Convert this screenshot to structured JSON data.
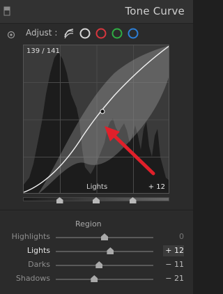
{
  "panel": {
    "title": "Tone Curve"
  },
  "adjust": {
    "label": "Adjust :",
    "channels": [
      {
        "name": "parametric",
        "icon": "parametric-curve-icon",
        "color": "#d0d0d0"
      },
      {
        "name": "rgb",
        "icon": "rgb-channel-icon",
        "color": "#d8d8d8"
      },
      {
        "name": "red",
        "icon": "red-channel-icon",
        "color": "#d9363e"
      },
      {
        "name": "green",
        "icon": "green-channel-icon",
        "color": "#2fae44"
      },
      {
        "name": "blue",
        "icon": "blue-channel-icon",
        "color": "#2c7fd8"
      }
    ]
  },
  "graph": {
    "readout": "139 / 141",
    "region_name": "Lights",
    "region_value": "+ 12",
    "annotation": {
      "icon": "red-arrow-icon",
      "color": "#e0202a"
    }
  },
  "split": {
    "handles": [
      0.25,
      0.5,
      0.75
    ]
  },
  "region": {
    "label": "Region",
    "sliders": [
      {
        "key": "highlights",
        "label": "Highlights",
        "value": "0",
        "amount": 0,
        "state": "muted"
      },
      {
        "key": "lights",
        "label": "Lights",
        "value": "+ 12",
        "amount": 12,
        "state": "active"
      },
      {
        "key": "darks",
        "label": "Darks",
        "value": "− 11",
        "amount": -11,
        "state": "normal"
      },
      {
        "key": "shadows",
        "label": "Shadows",
        "value": "− 21",
        "amount": -21,
        "state": "normal"
      }
    ]
  }
}
